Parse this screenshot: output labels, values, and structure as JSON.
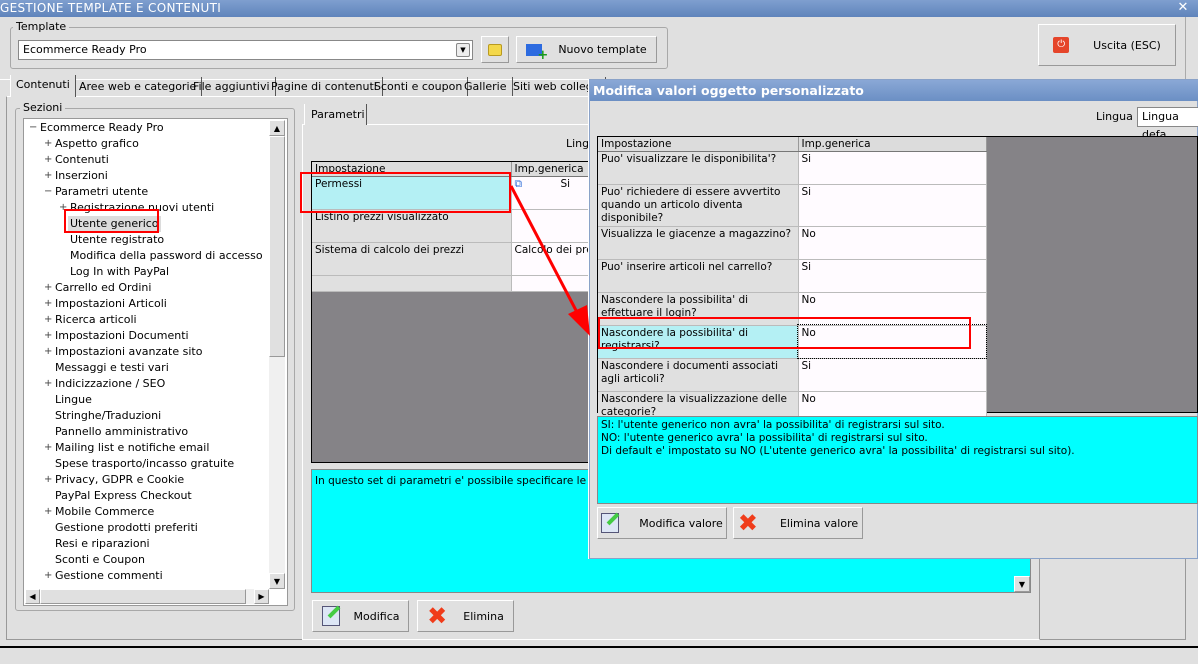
{
  "window": {
    "title": "GESTIONE TEMPLATE E CONTENUTI",
    "close_icon": "close-icon"
  },
  "template": {
    "label": "Template",
    "value": "Ecommerce Ready Pro",
    "new_label": "Nuovo template",
    "exit_label": "Uscita (ESC)"
  },
  "tabs": [
    "Contenuti",
    "Aree web e categorie",
    "File aggiuntivi",
    "Pagine di contenuti",
    "Sconti e coupon",
    "Gallerie",
    "Siti web collega"
  ],
  "sections": {
    "label": "Sezioni",
    "items": [
      {
        "label": "Ecommerce Ready Pro",
        "level": 0,
        "exp": "-"
      },
      {
        "label": "Aspetto grafico",
        "level": 1,
        "exp": "+"
      },
      {
        "label": "Contenuti",
        "level": 1,
        "exp": "+"
      },
      {
        "label": "Inserzioni",
        "level": 1,
        "exp": "+"
      },
      {
        "label": "Parametri utente",
        "level": 1,
        "exp": "-"
      },
      {
        "label": "Registrazione nuovi utenti",
        "level": 2,
        "exp": "+"
      },
      {
        "label": "Utente generico",
        "level": 2,
        "exp": "",
        "selected": true
      },
      {
        "label": "Utente registrato",
        "level": 2,
        "exp": ""
      },
      {
        "label": "Modifica della password di accesso",
        "level": 2,
        "exp": ""
      },
      {
        "label": "Log In with PayPal",
        "level": 2,
        "exp": ""
      },
      {
        "label": "Carrello ed Ordini",
        "level": 1,
        "exp": "+"
      },
      {
        "label": "Impostazioni Articoli",
        "level": 1,
        "exp": "+"
      },
      {
        "label": "Ricerca articoli",
        "level": 1,
        "exp": "+"
      },
      {
        "label": "Impostazioni Documenti",
        "level": 1,
        "exp": "+"
      },
      {
        "label": "Impostazioni avanzate sito",
        "level": 1,
        "exp": "+"
      },
      {
        "label": "Messaggi e testi vari",
        "level": 1,
        "exp": ""
      },
      {
        "label": "Indicizzazione / SEO",
        "level": 1,
        "exp": "+"
      },
      {
        "label": "Lingue",
        "level": 1,
        "exp": ""
      },
      {
        "label": "Stringhe/Traduzioni",
        "level": 1,
        "exp": ""
      },
      {
        "label": "Pannello amministrativo",
        "level": 1,
        "exp": ""
      },
      {
        "label": "Mailing list e notifiche email",
        "level": 1,
        "exp": "+"
      },
      {
        "label": "Spese trasporto/incasso gratuite",
        "level": 1,
        "exp": ""
      },
      {
        "label": "Privacy, GDPR e Cookie",
        "level": 1,
        "exp": "+"
      },
      {
        "label": "PayPal Express Checkout",
        "level": 1,
        "exp": ""
      },
      {
        "label": "Mobile Commerce",
        "level": 1,
        "exp": "+"
      },
      {
        "label": "Gestione prodotti preferiti",
        "level": 1,
        "exp": ""
      },
      {
        "label": "Resi e riparazioni",
        "level": 1,
        "exp": ""
      },
      {
        "label": "Sconti e Coupon",
        "level": 1,
        "exp": ""
      },
      {
        "label": "Gestione commenti",
        "level": 1,
        "exp": "+"
      }
    ]
  },
  "params": {
    "tab": "Parametri",
    "lingua_label": "Lingu",
    "col1": "Impostazione",
    "col2": "Imp.generica",
    "rows": [
      {
        "name": "Permessi",
        "value": "Si"
      },
      {
        "name": "Listino prezzi visualizzato",
        "value": ""
      },
      {
        "name": "Sistema di calcolo dei prezzi",
        "value": "Calcolo dei prez"
      }
    ],
    "description": "In questo set di parametri e' possibile specificare le abilitaz",
    "modify_label": "Modifica",
    "delete_label": "Elimina"
  },
  "dialog": {
    "title": "Modifica valori oggetto personalizzato",
    "lingua_label": "Lingua :",
    "lingua_value": "Lingua defa",
    "col1": "Impostazione",
    "col2": "Imp.generica",
    "rows": [
      {
        "name": "Puo' visualizzare le disponibilita'?",
        "value": "Si"
      },
      {
        "name": "Puo' richiedere di essere avvertito quando un articolo diventa disponibile?",
        "value": "Si"
      },
      {
        "name": "Visualizza le giacenze a magazzino?",
        "value": "No"
      },
      {
        "name": "Puo' inserire articoli nel carrello?",
        "value": "Si"
      },
      {
        "name": "Nascondere la possibilita' di effettuare il login?",
        "value": "No"
      },
      {
        "name": "Nascondere la possibilita' di registrarsi?",
        "value": "No",
        "selected": true
      },
      {
        "name": "Nascondere i documenti associati agli articoli?",
        "value": "Si"
      },
      {
        "name": "Nascondere la visualizzazione delle categorie?",
        "value": "No"
      }
    ],
    "description": [
      "SI: l'utente generico non avra' la possibilita' di registrarsi sul sito.",
      "NO: l'utente  generico avra' la possibilita' di registrarsi sul sito.",
      "Di default e' impostato su NO (L'utente  generico avra' la possibilita' di registrarsi sul sito)."
    ],
    "modify_label": "Modifica valore",
    "delete_label": "Elimina valore"
  },
  "colors": {
    "highlight": "#ff0000",
    "description_bg": "#00ffff",
    "selected_row": "#b4f0f4"
  }
}
